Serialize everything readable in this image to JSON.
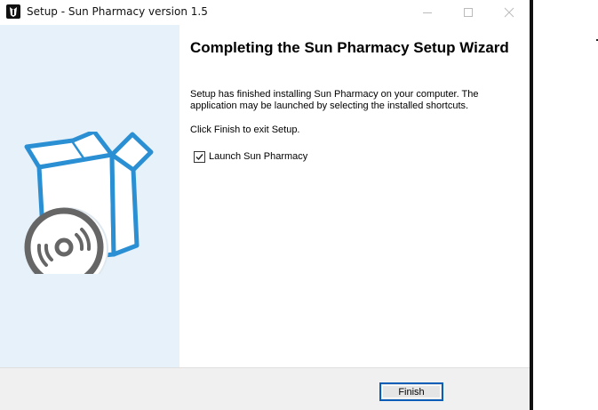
{
  "window": {
    "title": "Setup - Sun Pharmacy version 1.5",
    "app_icon": "installer-app-icon",
    "controls": [
      "minimize-icon",
      "maximize-icon",
      "close-icon"
    ]
  },
  "sidebar": {
    "illustration": "software-box-with-disc-icon",
    "colors": {
      "background": "#e7f1f9",
      "box_stroke": "#2b8fd4",
      "disc": "#666666"
    }
  },
  "content": {
    "heading": "Completing the Sun Pharmacy Setup Wizard",
    "paragraph1": "Setup has finished installing Sun Pharmacy on your computer. The application may be launched by selecting the installed shortcuts.",
    "paragraph2": "Click Finish to exit Setup.",
    "launch_checkbox": {
      "label": "Launch Sun Pharmacy",
      "checked": true
    }
  },
  "footer": {
    "finish_label": "Finish",
    "colors": {
      "background": "#f0f0f0",
      "button_border": "#0a5eb8"
    }
  }
}
